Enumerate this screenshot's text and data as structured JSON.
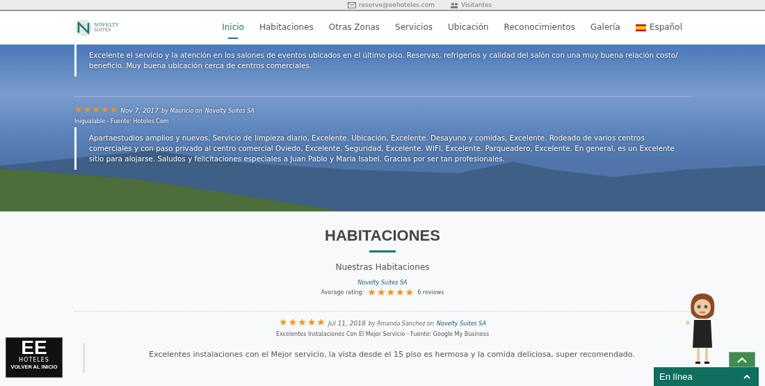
{
  "top_bar": {
    "items": [
      {
        "kind": "mail",
        "text": "reserve@eehoteles.com"
      },
      {
        "kind": "users",
        "text": "Visitantes"
      }
    ]
  },
  "nav": {
    "logo": {
      "name": "NOVELTY",
      "tagline": "SUITES"
    },
    "items": [
      {
        "label": "Inicio",
        "selected": true
      },
      {
        "label": "Habitaciones",
        "selected": false
      },
      {
        "label": "Otras Zonas",
        "selected": false
      },
      {
        "label": "Servicios",
        "selected": false
      },
      {
        "label": "Ubicación",
        "selected": false
      },
      {
        "label": "Reconocimientos",
        "selected": false
      },
      {
        "label": "Galería",
        "selected": false
      }
    ],
    "language": "Español"
  },
  "hero_reviews": [
    {
      "text": "Excelente el servicio y la atención en los salones de eventos ubicados en el último piso. Reservas, refrigerios y calidad del salón con una muy buena relación costo/ beneficio. Muy buena ubicación cerca de centros comerciales."
    },
    {
      "stars": 5,
      "date": "Nov 7, 2017",
      "by": "by Mauricio on",
      "place": "Novelty Suites SA",
      "source": "Inigualable - Fuente: Hoteles.Com",
      "text": "Apartaestudios amplios y nuevos. Servicio de limpieza diario, Excelente. Ubicación, Excelente. Desayuno y comidas, Excelente. Rodeado de varios centros comerciales y con paso privado al centro comercial Oviedo, Excelente. Seguridad, Excelente. WIFI, Excelente. Parqueadero, Excelente. En general, es un Excelente sitio para alojarse. Saludos y felicitaciones especiales a Juan Pablo y Maria Isabel. Gracias por ser tan profesionales."
    }
  ],
  "section": {
    "title": "HABITACIONES",
    "subtitle": "Nuestras Habitaciones",
    "place": "Novelty Suites SA",
    "rating_label": "Average rating:",
    "stars": 5,
    "reviews_count": "6 reviews",
    "review": {
      "stars": 5,
      "date": "Jul 11, 2018",
      "by": "by Amanda Sanchez on",
      "place": "Novelty Suites SA",
      "source": "Excelentes Instalaciones Con El Mejor Servicio - Fuente: Google My Business",
      "text": "Excelentes instalaciones con el Mejor servicio, la vista desde el 15 piso es hermosa y la comida deliciosa, super recomendado."
    }
  },
  "badge": {
    "brand": "EE",
    "name": "HOTELES",
    "link": "VOLVER AL INICIO"
  },
  "chat": {
    "label": "En línea"
  }
}
